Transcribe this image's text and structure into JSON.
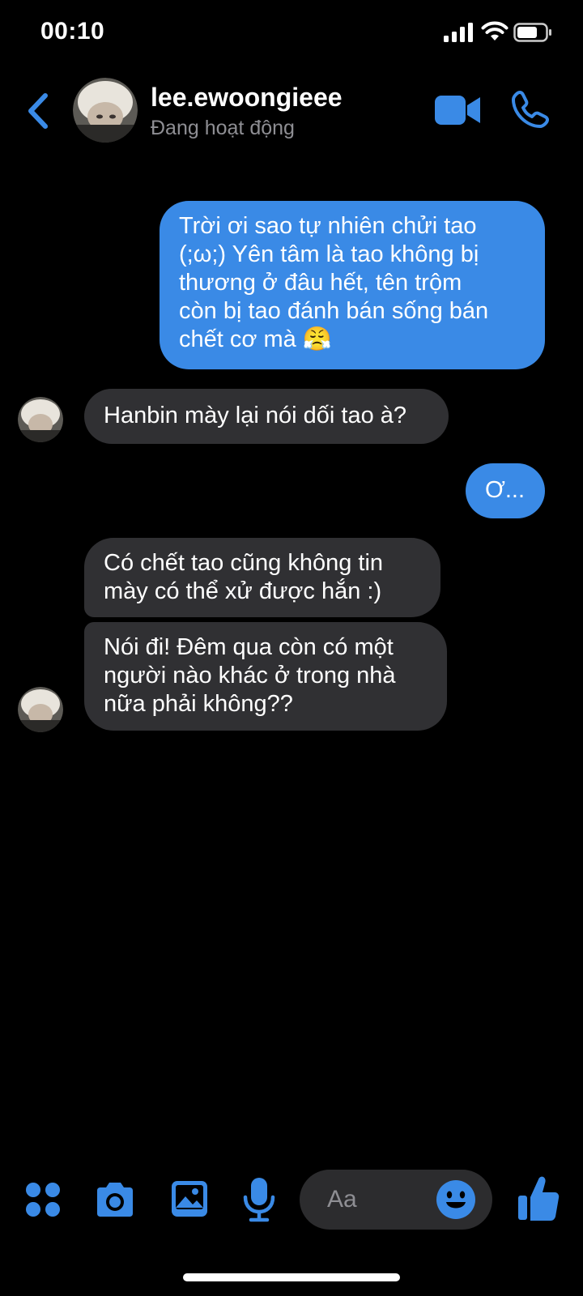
{
  "status_bar": {
    "time": "00:10"
  },
  "header": {
    "contact_name": "lee.ewoongieee",
    "contact_status": "Đang hoạt động"
  },
  "messages": [
    {
      "sender": "me",
      "text": "Trời ơi sao tự nhiên chửi tao\n(;ω;) Yên tâm là tao không bị\nthương ở đâu hết, tên trộm\ncòn bị tao đánh bán sống bán\nchết cơ mà 😤"
    },
    {
      "sender": "them",
      "text": "Hanbin mày lại nói dối tao à?"
    },
    {
      "sender": "me",
      "text": "Ơ..."
    },
    {
      "sender": "them",
      "text": "Có chết tao cũng không tin\nmày có thể xử được hắn :)"
    },
    {
      "sender": "them",
      "text": "Nói đi! Đêm qua còn có một\nngười nào khác ở trong nhà\nnữa phải không??"
    }
  ],
  "composer": {
    "placeholder": "Aa"
  },
  "colors": {
    "accent": "#3a8ae6",
    "incoming_bubble": "#303033",
    "background": "#000000"
  }
}
